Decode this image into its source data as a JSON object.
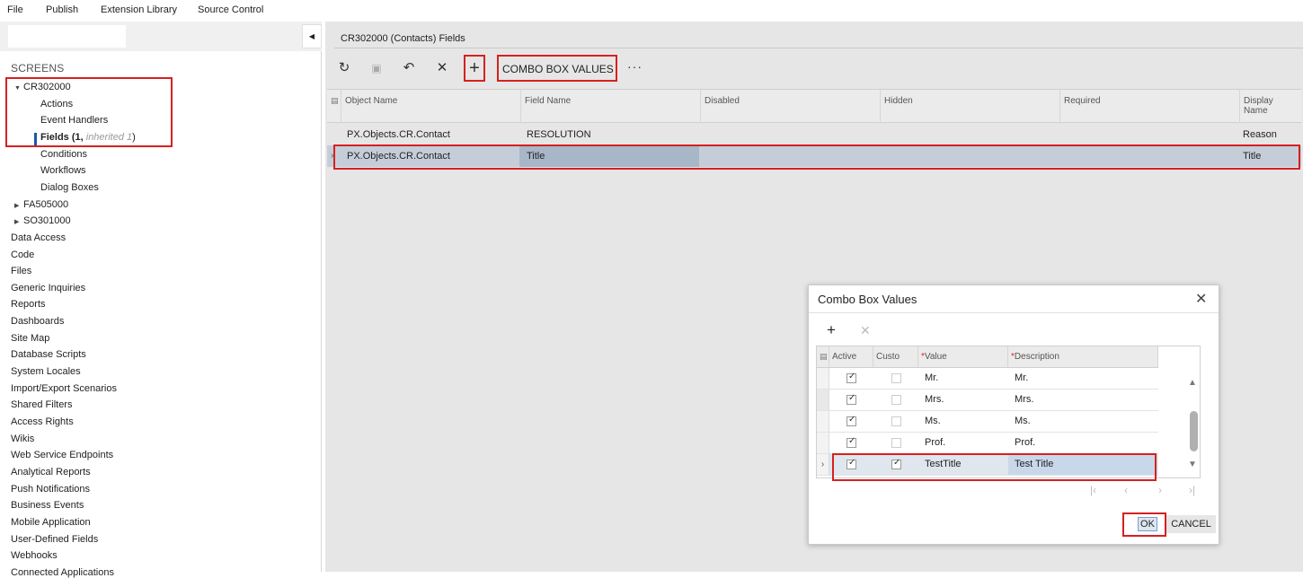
{
  "menubar": {
    "items": [
      "File",
      "Publish",
      "Extension Library",
      "Source Control"
    ]
  },
  "sidebar": {
    "header": "SCREENS",
    "screen1": {
      "id": "CR302000",
      "children": [
        "Actions",
        "Event Handlers",
        "Conditions",
        "Workflows",
        "Dialog Boxes"
      ],
      "fields_label": "Fields (1,",
      "fields_inherited": "inherited 1",
      "fields_close": ")"
    },
    "screen2": "FA505000",
    "screen3": "SO301000",
    "sections": [
      "Data Access",
      "Code",
      "Files",
      "Generic Inquiries",
      "Reports",
      "Dashboards",
      "Site Map",
      "Database Scripts",
      "System Locales",
      "Import/Export Scenarios",
      "Shared Filters",
      "Access Rights",
      "Wikis",
      "Web Service Endpoints",
      "Analytical Reports",
      "Push Notifications",
      "Business Events",
      "Mobile Application",
      "User-Defined Fields",
      "Webhooks",
      "Connected Applications"
    ]
  },
  "main": {
    "title": "CR302000 (Contacts) Fields",
    "toolbar": {
      "combo_label": "COMBO BOX VALUES",
      "more": "···"
    },
    "columns": [
      "Object Name",
      "Field Name",
      "Disabled",
      "Hidden",
      "Required",
      "Display Name"
    ],
    "rows": [
      {
        "object": "PX.Objects.CR.Contact",
        "field": "RESOLUTION",
        "display": "Reason"
      },
      {
        "object": "PX.Objects.CR.Contact",
        "field": "Title",
        "display": "Title"
      }
    ]
  },
  "modal": {
    "title": "Combo Box Values",
    "columns": {
      "active": "Active",
      "custom": "Custo",
      "value": "Value",
      "description": "Description"
    },
    "rows": [
      {
        "active": true,
        "custom": false,
        "value": "Mr.",
        "description": "Mr."
      },
      {
        "active": true,
        "custom": false,
        "value": "Mrs.",
        "description": "Mrs."
      },
      {
        "active": true,
        "custom": false,
        "value": "Ms.",
        "description": "Ms."
      },
      {
        "active": true,
        "custom": false,
        "value": "Prof.",
        "description": "Prof."
      },
      {
        "active": true,
        "custom": true,
        "value": "TestTitle",
        "description": "Test Title"
      }
    ],
    "ok_label": "OK",
    "cancel_label": "CANCEL"
  },
  "colors": {
    "highlight": "#d62020",
    "selection": "#c5ced8",
    "accent": "#1a5aa6"
  }
}
